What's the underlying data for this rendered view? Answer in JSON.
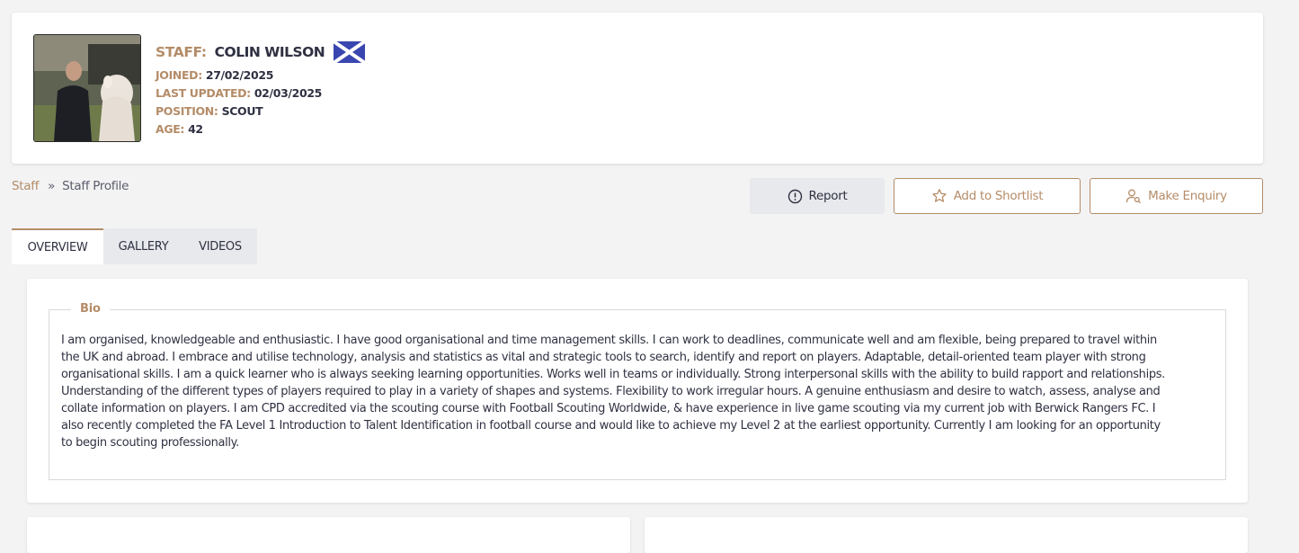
{
  "profile": {
    "name_label": "STAFF:",
    "name": "COLIN WILSON",
    "flag": "scotland-flag",
    "joined_label": "JOINED:",
    "joined": "27/02/2025",
    "updated_label": "LAST UPDATED:",
    "updated": "02/03/2025",
    "position_label": "POSITION:",
    "position": "SCOUT",
    "age_label": "AGE:",
    "age": "42"
  },
  "breadcrumb": {
    "root": "Staff",
    "separator": "»",
    "current": "Staff Profile"
  },
  "actions": {
    "report": "Report",
    "report_icon": "alert-circle-icon",
    "shortlist": "Add to Shortlist",
    "shortlist_icon": "star-icon",
    "enquiry": "Make Enquiry",
    "enquiry_icon": "user-search-icon"
  },
  "tabs": [
    "OVERVIEW",
    "GALLERY",
    "VIDEOS"
  ],
  "active_tab": "OVERVIEW",
  "bio": {
    "title": "Bio",
    "lines": [
      "I am organised, knowledgeable and enthusiastic. I have good organisational and time management skills. I can work to deadlines, communicate well and am flexible, being prepared to travel within",
      "the UK and abroad. I embrace and utilise technology, analysis and statistics as vital and strategic tools to search, identify and report on players. Adaptable, detail-oriented team player with strong",
      "organisational skills. I am a quick learner who is always seeking learning opportunities. Works well in teams or individually. Strong interpersonal skills with the ability to build rapport and relationships.",
      "Understanding of the different types of players required to play in a variety of shapes and systems. Flexibility to work irregular hours. A genuine enthusiasm and desire to watch, assess, analyse and",
      "collate information on players. I am CPD accredited via the scouting course with Football Scouting Worldwide, & have experience in live game scouting via my current job with Berwick Rangers FC. I",
      "also recently completed the FA Level 1 Introduction to Talent Identification in football course and would like to achieve my Level 2 at the earliest opportunity. Currently I am looking for an opportunity",
      "to begin scouting professionally."
    ]
  },
  "colors": {
    "accent": "#b48c68",
    "text": "#2f3142",
    "page_bg": "#f3f3f4",
    "flag_blue": "#3a46b0"
  }
}
